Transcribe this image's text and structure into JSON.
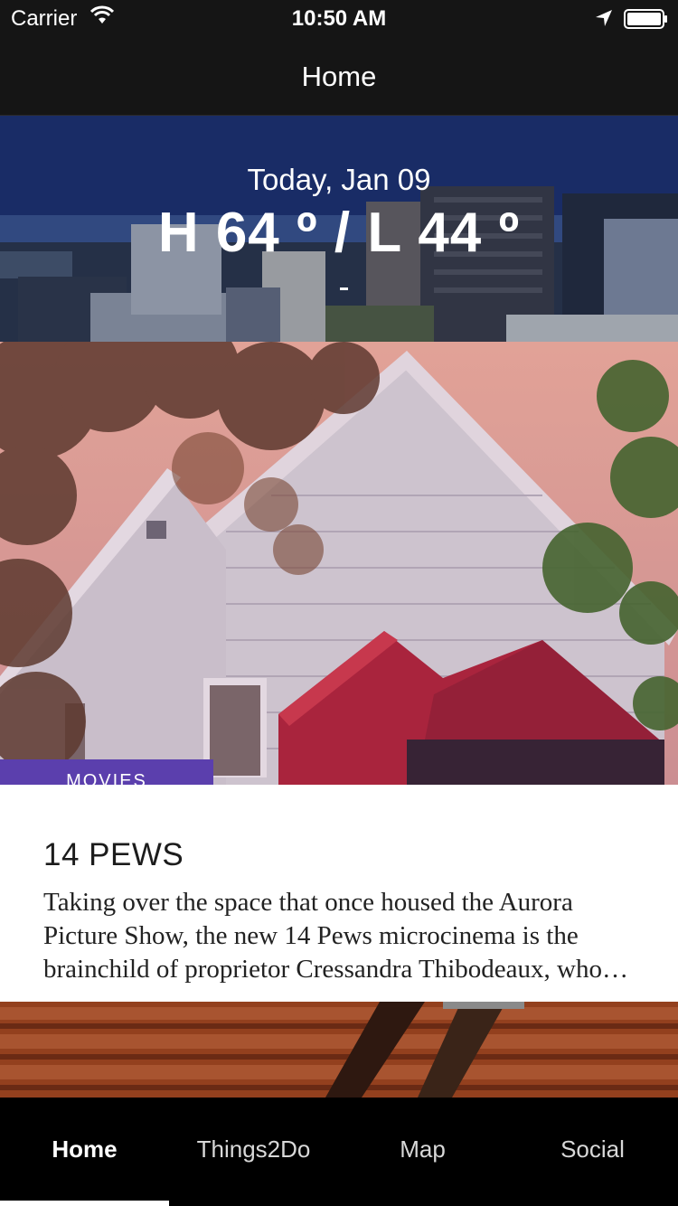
{
  "status_bar": {
    "carrier": "Carrier",
    "time": "10:50 AM",
    "icons": [
      "wifi-icon",
      "location-arrow-icon",
      "battery-icon"
    ]
  },
  "nav": {
    "title": "Home"
  },
  "weather": {
    "date": "Today, Jan 09",
    "temperature": "H 64 º / L 44 º",
    "detail": "-"
  },
  "featured": {
    "category": "MOVIES",
    "title": "14 PEWS",
    "description": "Taking over the space that once housed the Aurora Picture Show, the new 14 Pews microcinema is the brainchild of proprietor Cressandra Thibodeaux, who presents a mix of independent films, documentaries, and art house screenings."
  },
  "tabs": [
    {
      "label": "Home",
      "active": true
    },
    {
      "label": "Things2Do",
      "active": false
    },
    {
      "label": "Map",
      "active": false
    },
    {
      "label": "Social",
      "active": false
    }
  ],
  "colors": {
    "accent": "#5b3fad",
    "bar_background": "#151515",
    "tab_background": "#000000"
  }
}
